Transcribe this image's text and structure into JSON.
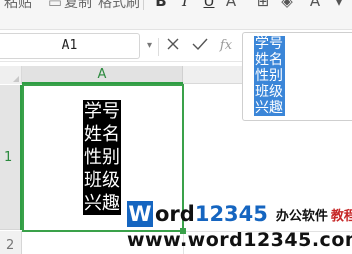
{
  "toolbar": {
    "text_1": "粘贴",
    "text_2": "复制",
    "text_3": "格式刷"
  },
  "formula_bar": {
    "cell_reference": "A1",
    "cancel_icon": "close-icon",
    "confirm_icon": "check-icon",
    "fx_label": "fx",
    "content_lines": [
      "学号",
      "姓名",
      "性别",
      "班级",
      "兴趣"
    ]
  },
  "sheet": {
    "column_header": "A",
    "row_headers": [
      "1",
      "2"
    ],
    "cell_A1_lines": [
      "学号",
      "姓名",
      "性别",
      "班级",
      "兴趣"
    ]
  },
  "watermark": {
    "logo_letter": "W",
    "logo_rest": "ord",
    "logo_number": "12345",
    "tagline_main": "办公软件",
    "tagline_accent": "教程",
    "url": "www.word12345.com"
  },
  "colors": {
    "selection_green": "#3aa14a",
    "formula_highlight": "#3b86d8",
    "cell_highlight": "#000000",
    "watermark_blue": "#1565c0",
    "watermark_red": "#c62828"
  }
}
